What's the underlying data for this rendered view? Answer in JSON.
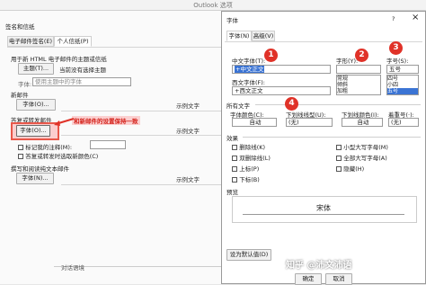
{
  "window_title": "Outlook 选项",
  "left": {
    "section_label": "签名和信纸",
    "tabs": [
      "电子邮件签名(E)",
      "个人信纸(P)"
    ],
    "theme_group": "用于新 HTML 电子邮件的主题或信纸",
    "theme_button": "主题(T)...",
    "theme_status": "当前没有选择主题",
    "font_label": "字体:",
    "font_select": "使用主题中的字体",
    "new_mail": "新邮件",
    "font_button": "字体(O)...",
    "sample": "示例文字",
    "reply_group": "答复或转发邮件",
    "reply_font_button": "字体(O)...",
    "check1": "标记我的注释(M):",
    "check2": "答复或转发时选取新颜色(C)",
    "plain_group": "撰写和阅读纯文本邮件",
    "plain_font_button": "字体(N)...",
    "sample2": "示例文字",
    "sample3": "示例文字",
    "annotation": "和新邮件的设置保持一致",
    "bottom_label": "对话语境"
  },
  "dialog": {
    "title": "字体",
    "help": "?",
    "close": "×",
    "tabs": [
      "字体(N)",
      "高级(V)"
    ],
    "cn_font_label": "中文字体(T):",
    "cn_font_value": "+中文正文",
    "style_label": "字形(Y):",
    "size_label": "字号(S):",
    "size_value": "五号",
    "west_font_label": "西文字体(F):",
    "west_font_value": "+西文正文",
    "styles": [
      "常规",
      "倾斜",
      "加粗"
    ],
    "sizes": [
      "四号",
      "小四",
      "五号"
    ],
    "all_text": "所有文字",
    "font_color_label": "字体颜色(C):",
    "font_color": "自动",
    "underline_label": "下划线线型(U):",
    "underline_value": "(无)",
    "underline_color_label": "下划线颜色(I):",
    "underline_color": "自动",
    "emphasis_label": "着重号(·):",
    "emphasis_value": "(无)",
    "effects_label": "效果",
    "effects_left": [
      "删除线(K)",
      "双删除线(L)",
      "上标(P)",
      "下标(B)"
    ],
    "effects_right": [
      "小型大写字母(M)",
      "全部大写字母(A)",
      "隐藏(H)"
    ],
    "preview_label": "预览",
    "preview_text": "宋体",
    "default_button": "设为默认值(D)",
    "watermark": "知乎 @沛文沛语",
    "ok": "确定",
    "cancel": "取消",
    "badges": [
      "1",
      "2",
      "3",
      "4"
    ]
  },
  "colors": {
    "accent_red": "#e03228",
    "highlight_blue": "#3b74d4"
  }
}
